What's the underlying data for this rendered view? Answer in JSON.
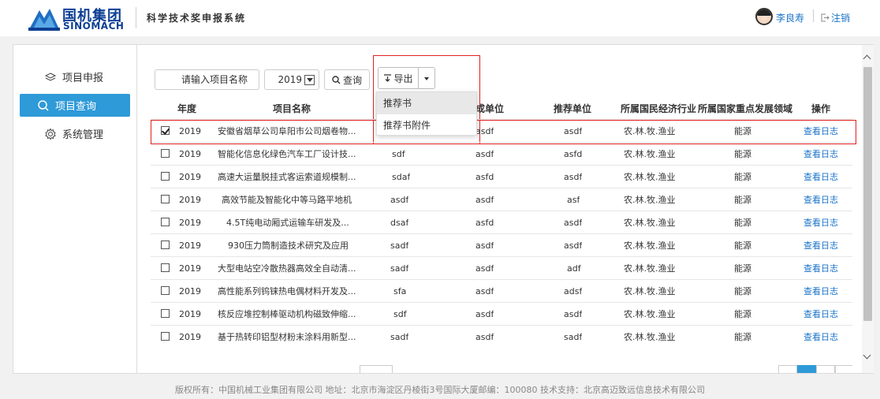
{
  "header": {
    "logo_cn": "国机集团",
    "logo_en": "SINOMACH",
    "system_title": "科学技术奖申报系统",
    "user_name": "李良寿",
    "logout": "注销"
  },
  "sidebar": {
    "items": [
      {
        "label": "项目申报",
        "icon": "layers-icon"
      },
      {
        "label": "项目查询",
        "icon": "search-icon",
        "active": true
      },
      {
        "label": "系统管理",
        "icon": "gear-icon"
      }
    ]
  },
  "toolbar": {
    "search_placeholder": "请输入项目名称",
    "year": "2019",
    "query_label": "查询",
    "export_label": "导出",
    "export_menu": [
      "推荐书",
      "推荐书附件"
    ]
  },
  "table": {
    "columns": [
      "年度",
      "项目名称",
      "完成单位",
      "推荐单位",
      "所属国民经济行业",
      "所属国家重点发展领域",
      "操作"
    ],
    "rows": [
      {
        "checked": true,
        "year": "2019",
        "name": "安徽省烟草公司阜阳市公司烟卷物...",
        "complete": "asdf",
        "recommend": "asdf",
        "industry": "农.林.牧.渔业",
        "field": "能源",
        "action": "查看日志"
      },
      {
        "checked": false,
        "year": "2019",
        "name": "智能化信息化绿色汽车工厂设计技...",
        "col3": "sdf",
        "complete": "asdf",
        "recommend": "asfd",
        "industry": "农.林.牧.渔业",
        "field": "能源",
        "action": "查看日志"
      },
      {
        "checked": false,
        "year": "2019",
        "name": "高速大运量脱挂式客运索道规模制...",
        "col3": "sdaf",
        "complete": "asfd",
        "recommend": "asdf",
        "industry": "农.林.牧.渔业",
        "field": "能源",
        "action": "查看日志"
      },
      {
        "checked": false,
        "year": "2019",
        "name": "高效节能及智能化中等马路平地机",
        "col3": "asdf",
        "complete": "asdf",
        "recommend": "asf",
        "industry": "农.林.牧.渔业",
        "field": "能源",
        "action": "查看日志"
      },
      {
        "checked": false,
        "year": "2019",
        "name": "4.5T纯电动厢式运输车研发及...",
        "col3": "dsaf",
        "complete": "asfd",
        "recommend": "asdf",
        "industry": "农.林.牧.渔业",
        "field": "能源",
        "action": "查看日志"
      },
      {
        "checked": false,
        "year": "2019",
        "name": "930压力筒制造技术研究及应用",
        "col3": "sadf",
        "complete": "asdf",
        "recommend": "asdf",
        "industry": "农.林.牧.渔业",
        "field": "能源",
        "action": "查看日志"
      },
      {
        "checked": false,
        "year": "2019",
        "name": "大型电站空冷散热器高效全自动清...",
        "col3": "sadf",
        "complete": "asdf",
        "recommend": "adf",
        "industry": "农.林.牧.渔业",
        "field": "能源",
        "action": "查看日志"
      },
      {
        "checked": false,
        "year": "2019",
        "name": "高性能系列钨铼热电偶材料开发及...",
        "col3": "sfa",
        "complete": "asdf",
        "recommend": "adsf",
        "industry": "农.林.牧.渔业",
        "field": "能源",
        "action": "查看日志"
      },
      {
        "checked": false,
        "year": "2019",
        "name": "核反应堆控制棒驱动机构磁致伸缩...",
        "col3": "sdf",
        "complete": "asdf",
        "recommend": "asdf",
        "industry": "农.林.牧.渔业",
        "field": "能源",
        "action": "查看日志"
      },
      {
        "checked": false,
        "year": "2019",
        "name": "基于热转印铝型材粉末涂料用新型...",
        "col3": "sadf",
        "complete": "asdf",
        "recommend": "sadf",
        "industry": "农.林.牧.渔业",
        "field": "能源",
        "action": "查看日志"
      }
    ]
  },
  "footer": "版权所有：中国机械工业集团有限公司 地址：北京市海淀区丹棱街3号国际大厦邮编：100080 技术支持：北京高迈致远信息技术有限公司",
  "colors": {
    "accent": "#2f9ad8",
    "link": "#1a73c9",
    "brand": "#0b3f94",
    "highlight": "#e02020"
  }
}
